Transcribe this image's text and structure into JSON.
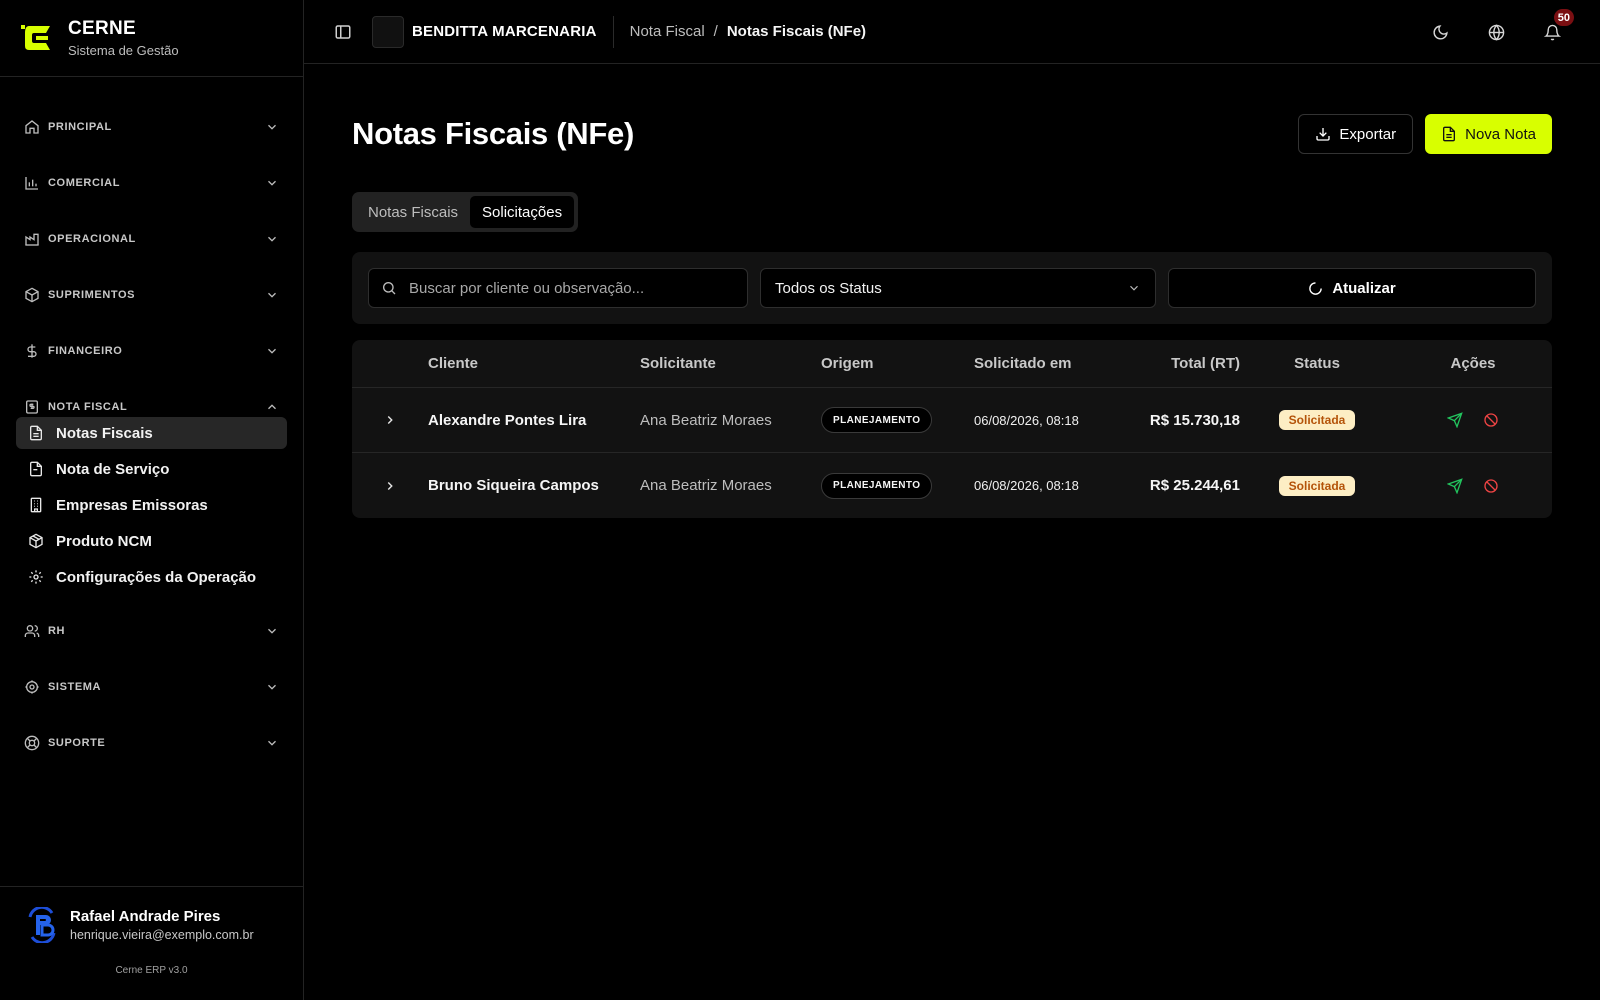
{
  "brand": {
    "name": "CERNE",
    "subtitle": "Sistema de Gestão",
    "accent": "#d8ff00"
  },
  "sidebar": {
    "sections": [
      {
        "label": "PRINCIPAL",
        "icon": "home-icon",
        "expanded": false
      },
      {
        "label": "COMERCIAL",
        "icon": "bar-chart-icon",
        "expanded": false
      },
      {
        "label": "OPERACIONAL",
        "icon": "factory-icon",
        "expanded": false
      },
      {
        "label": "SUPRIMENTOS",
        "icon": "package-icon",
        "expanded": false
      },
      {
        "label": "FINANCEIRO",
        "icon": "dollar-icon",
        "expanded": false
      },
      {
        "label": "NOTA FISCAL",
        "icon": "receipt-icon",
        "expanded": true,
        "items": [
          {
            "label": "Notas Fiscais",
            "icon": "file-text-icon",
            "active": true
          },
          {
            "label": "Nota de Serviço",
            "icon": "file-icon",
            "active": false
          },
          {
            "label": "Empresas Emissoras",
            "icon": "building-icon",
            "active": false
          },
          {
            "label": "Produto NCM",
            "icon": "box-icon",
            "active": false
          },
          {
            "label": "Configurações da Operação",
            "icon": "gear-icon",
            "active": false
          }
        ]
      },
      {
        "label": "RH",
        "icon": "users-icon",
        "expanded": false
      },
      {
        "label": "SISTEMA",
        "icon": "settings-icon",
        "expanded": false
      },
      {
        "label": "SUPORTE",
        "icon": "lifebuoy-icon",
        "expanded": false
      }
    ]
  },
  "user": {
    "name": "Rafael Andrade Pires",
    "email": "henrique.vieira@exemplo.com.br",
    "version": "Cerne ERP v3.0"
  },
  "topbar": {
    "company": "BENDITTA MARCENARIA",
    "breadcrumb": [
      "Nota Fiscal",
      "Notas Fiscais (NFe)"
    ],
    "breadcrumb_sep": "/",
    "notifications": "50"
  },
  "page": {
    "title": "Notas Fiscais (NFe)",
    "export_label": "Exportar",
    "new_label": "Nova Nota",
    "tabs": [
      {
        "label": "Notas Fiscais",
        "active": false
      },
      {
        "label": "Solicitações",
        "active": true
      }
    ]
  },
  "filters": {
    "search_placeholder": "Buscar por cliente ou observação...",
    "status_selected": "Todos os Status",
    "refresh_label": "Atualizar"
  },
  "table": {
    "headers": {
      "cliente": "Cliente",
      "solicitante": "Solicitante",
      "origem": "Origem",
      "data": "Solicitado em",
      "total": "Total (RT)",
      "status": "Status",
      "acoes": "Ações"
    },
    "rows": [
      {
        "cliente": "Alexandre Pontes Lira",
        "solicitante": "Ana Beatriz Moraes",
        "origem": "PLANEJAMENTO",
        "data": "06/08/2026, 08:18",
        "total": "R$ 15.730,18",
        "status": "Solicitada"
      },
      {
        "cliente": "Bruno Siqueira Campos",
        "solicitante": "Ana Beatriz Moraes",
        "origem": "PLANEJAMENTO",
        "data": "06/08/2026, 08:18",
        "total": "R$ 25.244,61",
        "status": "Solicitada"
      }
    ]
  },
  "colors": {
    "status_bg": "#fdeec4",
    "status_fg": "#b45309",
    "send": "#22c55e",
    "cancel": "#ef4444"
  }
}
